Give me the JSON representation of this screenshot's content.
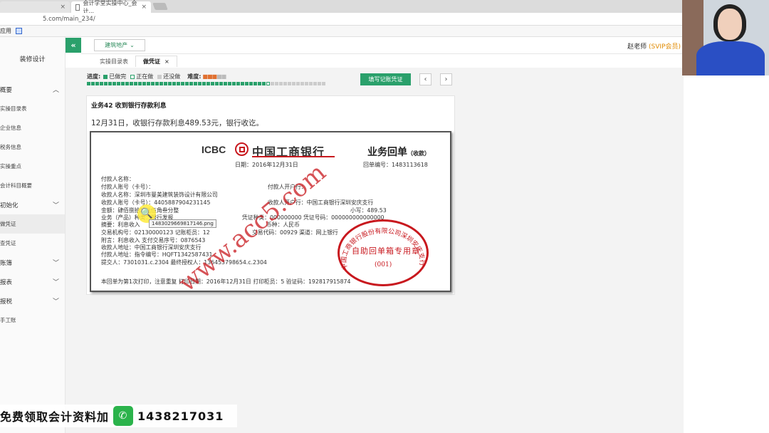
{
  "browser": {
    "tab1": "",
    "tab2": "会计学堂实操中心_会计...",
    "url": "5.com/main_234/",
    "bookmark": "应用"
  },
  "sidebar": {
    "title": "装修设计",
    "items": [
      {
        "label": "概要",
        "chevron": "up"
      },
      {
        "label": "实操目录表"
      },
      {
        "label": "企业信息"
      },
      {
        "label": "税务信息"
      },
      {
        "label": "实操重点"
      },
      {
        "label": "会计科目概要"
      },
      {
        "label": "初始化",
        "chevron": "down"
      },
      {
        "label": "做凭证",
        "active": true
      },
      {
        "label": "查凭证"
      },
      {
        "label": "账簿",
        "chevron": "down"
      },
      {
        "label": "报表",
        "chevron": "down"
      },
      {
        "label": "报税",
        "chevron": "down"
      },
      {
        "label": "手工账"
      }
    ]
  },
  "topbar": {
    "company": "建筑地产",
    "user": "赵老师",
    "vip": "(SVIP会员)"
  },
  "page_tabs": {
    "tab1": "实操目录表",
    "tab2": "做凭证",
    "close": "×"
  },
  "progress": {
    "label": "进度:",
    "done": "已做完",
    "doing": "正在做",
    "todo": "还没做",
    "difficulty_label": "难度:",
    "difficulty_stars": 3,
    "difficulty_max": 5,
    "done_count": 42,
    "total_count": 56,
    "fill_button": "填写记账凭证",
    "prev": "‹",
    "next": "›"
  },
  "task": {
    "title": "业务42 收到银行存款利息",
    "desc": "12月31日，收银行存款利息489.53元，银行收讫。"
  },
  "receipt": {
    "icbc": "ICBC",
    "bank": "中国工商银行",
    "title": "业务回单",
    "title_sub": "（收款）",
    "date": "日期：2016年12月31日",
    "no": "回单编号：1483113618",
    "lines": [
      "付款人名称：",
      "付款人账号（卡号）：",
      "收款人名称：深圳市曼美建筑装饰设计有限公司",
      "收款人账号（卡号）：4405887904231145",
      "金额：肆佰捌拾玖元伍角叁分整",
      "业务（产品）种类：银行发报",
      "摘要：利息收入",
      "交易机构号：02130000123    记账柜员：12",
      "附言：利息收入     支付交易序号：0876543",
      "收款人地址：中国工商银行深圳安庆支行",
      "付款人地址：指令编号：HQFT1342587431",
      "提交人：7301031.c.2304  最终授权人：136453798654.c.2304"
    ],
    "right_lines": [
      "付款人开户行：",
      "收款人开户行：中国工商银行深圳安庆支行",
      "小写：489.53",
      "凭证种类：000000000  凭证号码：000000000000000",
      "币种：人民币",
      "交易代码：00929    渠道：网上银行"
    ],
    "footer": "本回单为第1次打印，注意重复   打印日期：2016年12月31日   打印柜员：5   验证码：192817915874",
    "stamp_ring": "中国工商银行股份有限公司深圳安庆支行",
    "stamp_text": "自助回单箱专用章",
    "stamp_code": "(001)"
  },
  "overlay": {
    "watermark": "www.acc5.com",
    "tooltip": "1483029669817146.png"
  },
  "promo": {
    "text": "免费领取会计资料加",
    "phone": "1438217031"
  },
  "colors": {
    "accent": "#2aa06b",
    "bank_red": "#c8181e",
    "vip": "#e08a00"
  }
}
